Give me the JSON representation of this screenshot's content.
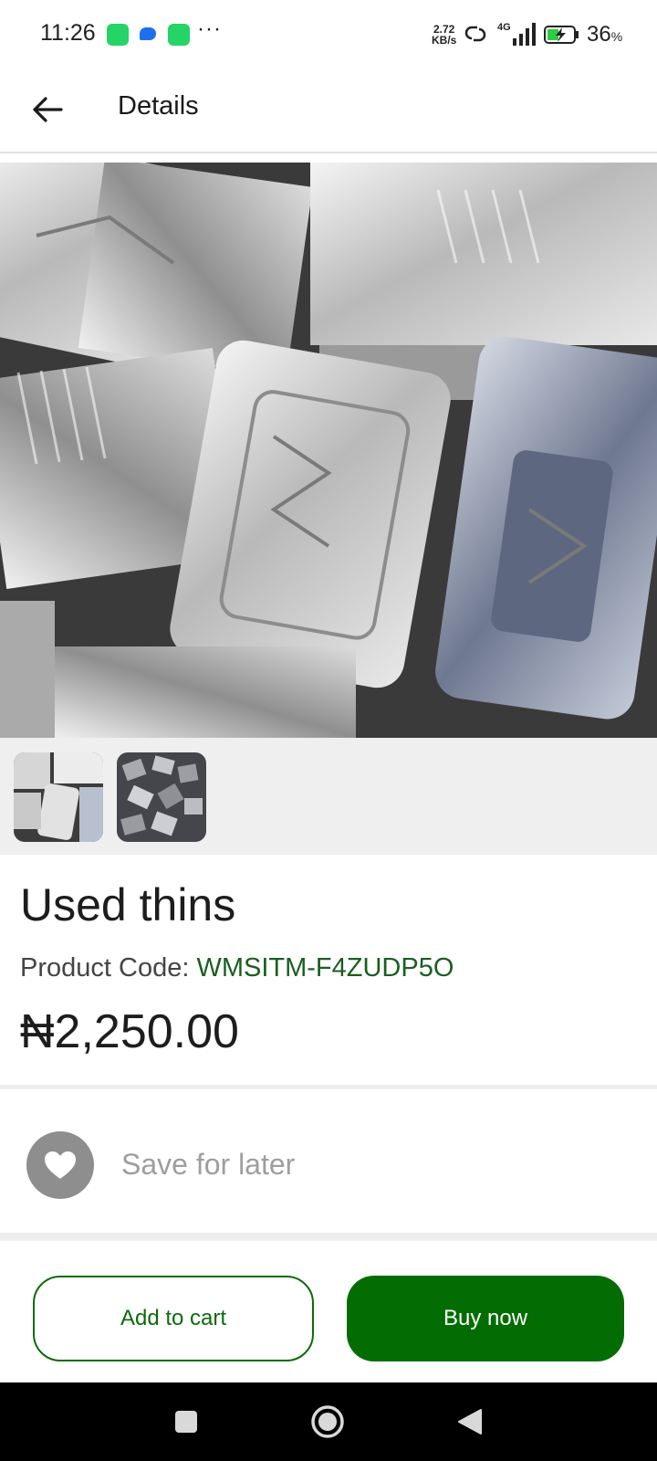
{
  "status_bar": {
    "time": "11:26",
    "more": "···",
    "speed_value": "2.72",
    "speed_unit": "KB/s",
    "network": "4G",
    "battery_percent": "36",
    "battery_unit": "%"
  },
  "app_bar": {
    "title": "Details",
    "back_icon": "arrow-left-icon"
  },
  "product": {
    "images": [
      {
        "name": "aluminium foil trays close-up"
      },
      {
        "name": "aluminium foil trays pile"
      }
    ],
    "selected_image": 0,
    "name": "Used thins",
    "code_label": "Product Code:",
    "code_value": "WMSITM-F4ZUDP5O",
    "price": "₦2,250.00"
  },
  "save_for_later": {
    "label": "Save for later",
    "icon": "heart-icon"
  },
  "actions": {
    "add_to_cart": "Add to cart",
    "buy_now": "Buy now"
  },
  "colors": {
    "primary_green": "#036d03",
    "code_green": "#1b5e20",
    "thumb_bg": "#efefef",
    "heart_circle": "#8e8e8e"
  },
  "nav_bar": {
    "icons": [
      "recents-square-icon",
      "home-circle-icon",
      "back-triangle-icon"
    ]
  }
}
